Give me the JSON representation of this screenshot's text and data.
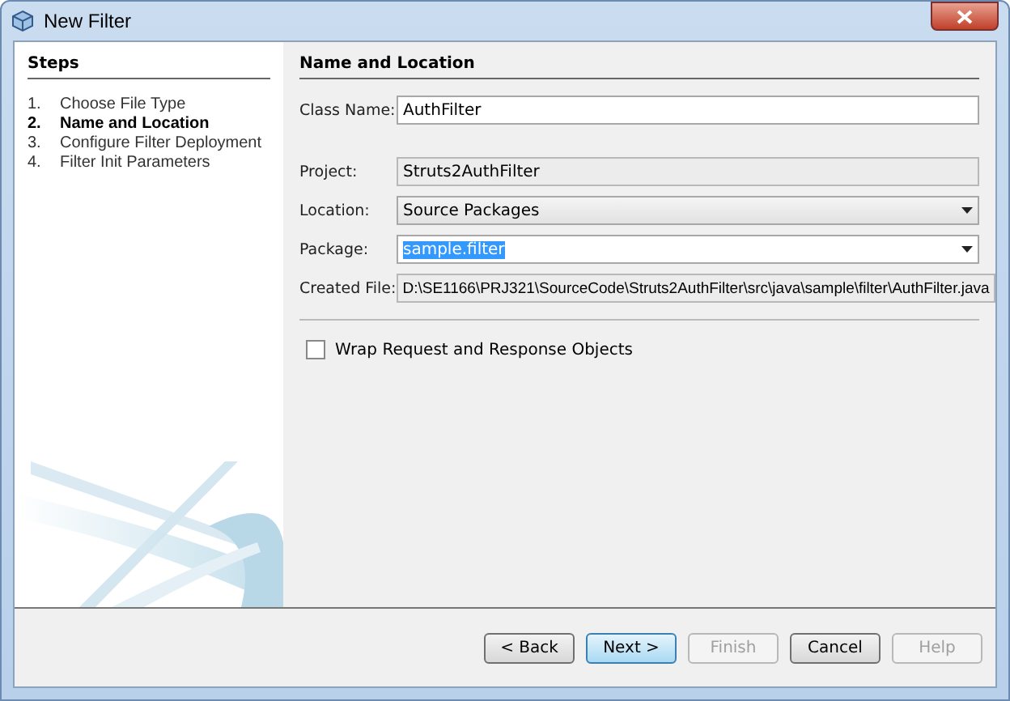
{
  "window": {
    "title": "New Filter"
  },
  "steps": {
    "title": "Steps",
    "items": [
      {
        "number": "1.",
        "label": "Choose File Type",
        "selected": false
      },
      {
        "number": "2.",
        "label": "Name and Location",
        "selected": true
      },
      {
        "number": "3.",
        "label": "Configure Filter Deployment",
        "selected": false
      },
      {
        "number": "4.",
        "label": "Filter Init Parameters",
        "selected": false
      }
    ]
  },
  "panel": {
    "title": "Name and Location",
    "fields": [
      {
        "kind": "text",
        "label": "Class Name:",
        "value": "AuthFilter"
      },
      {
        "kind": "readonly",
        "label": "Project:",
        "value": "Struts2AuthFilter"
      },
      {
        "kind": "combo",
        "label": "Location:",
        "value": "Source Packages",
        "editable": false
      },
      {
        "kind": "combo",
        "label": "Package:",
        "value": "sample.filter",
        "editable": true,
        "highlighted": true
      },
      {
        "kind": "readonly",
        "label": "Created File:",
        "value": "D:\\SE1166\\PRJ321\\SourceCode\\Struts2AuthFilter\\src\\java\\sample\\filter\\AuthFilter.java"
      }
    ],
    "checkbox": {
      "label": "Wrap Request and Response Objects",
      "checked": false
    }
  },
  "buttons": [
    {
      "label": "< Back",
      "disabled": false,
      "default": false
    },
    {
      "label": "Next >",
      "disabled": false,
      "default": true
    },
    {
      "label": "Finish",
      "disabled": true,
      "default": false
    },
    {
      "label": "Cancel",
      "disabled": false,
      "default": false
    },
    {
      "label": "Help",
      "disabled": true,
      "default": false
    }
  ]
}
